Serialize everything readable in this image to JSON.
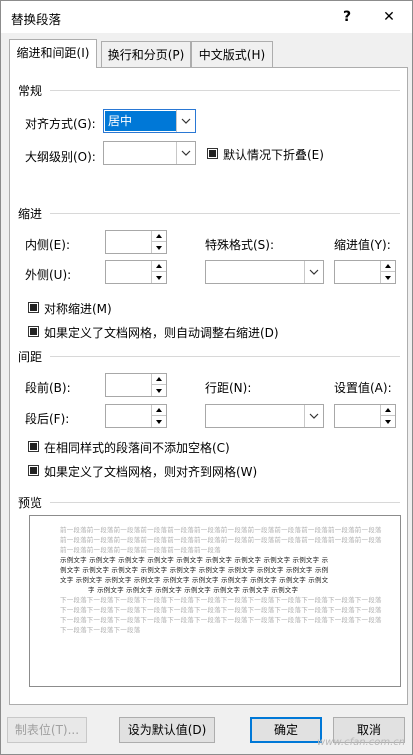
{
  "window": {
    "title": "替换段落",
    "help": "?",
    "close": "✕"
  },
  "tabs": [
    {
      "label": "缩进和间距(I)"
    },
    {
      "label": "换行和分页(P)"
    },
    {
      "label": "中文版式(H)"
    }
  ],
  "general": {
    "heading": "常规",
    "alignment_label": "对齐方式(G):",
    "alignment_value": "居中",
    "outline_label": "大纲级别(O):",
    "outline_value": "",
    "collapse_label": "默认情况下折叠(E)"
  },
  "indent": {
    "heading": "缩进",
    "left_label": "内侧(E):",
    "right_label": "外侧(U):",
    "special_label": "特殊格式(S):",
    "by_label": "缩进值(Y):",
    "mirror_label": "对称缩进(M)",
    "grid_adjust_label": "如果定义了文档网格，则自动调整右缩进(D)"
  },
  "spacing": {
    "heading": "间距",
    "before_label": "段前(B):",
    "after_label": "段后(F):",
    "line_label": "行距(N):",
    "at_label": "设置值(A):",
    "no_space_label": "在相同样式的段落间不添加空格(C)",
    "snap_grid_label": "如果定义了文档网格，则对齐到网格(W)"
  },
  "preview": {
    "heading": "预览",
    "prev_lines": [
      "前一段落前一段落前一段落前一段落前一段落前一段落前一段落前一段落前一段落前一段落前一段落前一段落",
      "前一段落前一段落前一段落前一段落前一段落前一段落前一段落前一段落前一段落前一段落前一段落前一段落",
      "前一段落前一段落前一段落前一段落前一段落前一段落"
    ],
    "sample_lines": [
      "示例文字 示例文字 示例文字 示例文字 示例文字 示例文字 示例文字 示例文字 示例文字 示",
      "例文字 示例文字 示例文字 示例文字 示例文字 示例文字 示例文字 示例文字 示例文字 示例",
      "文字 示例文字 示例文字 示例文字 示例文字 示例文字 示例文字 示例文字 示例文字 示例文",
      "字 示例文字 示例文字 示例文字 示例文字 示例文字 示例文字 示例文字"
    ],
    "next_lines": [
      "下一段落下一段落下一段落下一段落下一段落下一段落下一段落下一段落下一段落下一段落下一段落下一段落",
      "下一段落下一段落下一段落下一段落下一段落下一段落下一段落下一段落下一段落下一段落下一段落下一段落",
      "下一段落下一段落下一段落下一段落下一段落下一段落下一段落下一段落下一段落下一段落下一段落下一段落",
      "下一段落下一段落下一段落"
    ]
  },
  "buttons": {
    "tabs": "制表位(T)...",
    "set_default": "设为默认值(D)",
    "ok": "确定",
    "cancel": "取消"
  },
  "watermark": "www.cfan.com.cn",
  "colors": {
    "accent": "#0078d7",
    "panel": "#ffffff",
    "background": "#f0f0f0"
  }
}
